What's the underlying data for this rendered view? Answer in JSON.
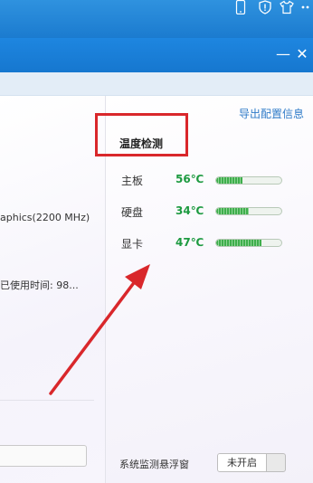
{
  "titlebar": {
    "icons": [
      "phone-icon",
      "shield-icon",
      "shirt-icon",
      "more-icon"
    ]
  },
  "window": {
    "minimize_glyph": "—",
    "close_glyph": "✕"
  },
  "left_panel": {
    "gpu_fragment": "aphics(2200 MHz)",
    "usage_fragment": "已使用时间: 98..."
  },
  "right_panel": {
    "export_link": "导出配置信息",
    "section_title": "温度检测",
    "rows": [
      {
        "label": "主板",
        "temp": "56℃",
        "level": 0.4
      },
      {
        "label": "硬盘",
        "temp": "34℃",
        "level": 0.5
      },
      {
        "label": "显卡",
        "temp": "47℃",
        "level": 0.7
      }
    ],
    "float_label": "系统监测悬浮窗",
    "toggle_state": "未开启"
  },
  "colors": {
    "annotation_red": "#d9272b",
    "temp_green": "#1d9a40",
    "link_blue": "#2f7bc8",
    "title_blue": "#1b7bcf"
  }
}
